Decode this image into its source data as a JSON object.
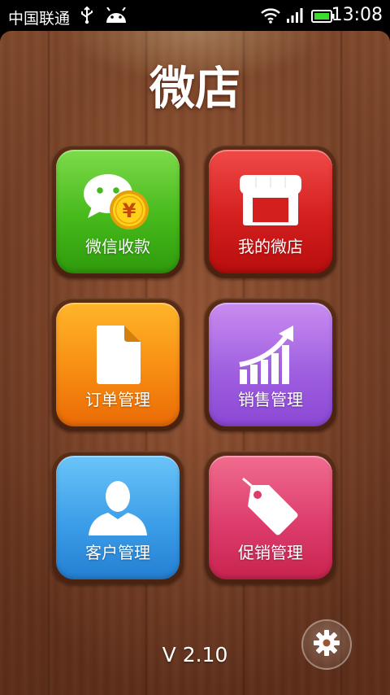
{
  "status_bar": {
    "carrier": "中国联通",
    "time": "13:08",
    "icons": [
      "usb-icon",
      "android-icon",
      "wifi-icon",
      "signal-icon",
      "battery-icon"
    ]
  },
  "app": {
    "title": "微店",
    "version": "V 2.10"
  },
  "tiles": [
    {
      "label": "微信收款",
      "icon": "wechat-payment-icon",
      "color": "#46b91b"
    },
    {
      "label": "我的微店",
      "icon": "storefront-icon",
      "color": "#d31f1e"
    },
    {
      "label": "订单管理",
      "icon": "document-icon",
      "color": "#f78d12"
    },
    {
      "label": "销售管理",
      "icon": "growth-chart-icon",
      "color": "#a060e0"
    },
    {
      "label": "客户管理",
      "icon": "user-icon",
      "color": "#3c9ee8"
    },
    {
      "label": "促销管理",
      "icon": "price-tag-icon",
      "color": "#dd3d6c"
    }
  ],
  "settings": {
    "icon": "gear-icon"
  },
  "colors": {
    "wood": "#8b4a2c",
    "tile_frame": "#5a2c16",
    "text": "#ffffff"
  }
}
